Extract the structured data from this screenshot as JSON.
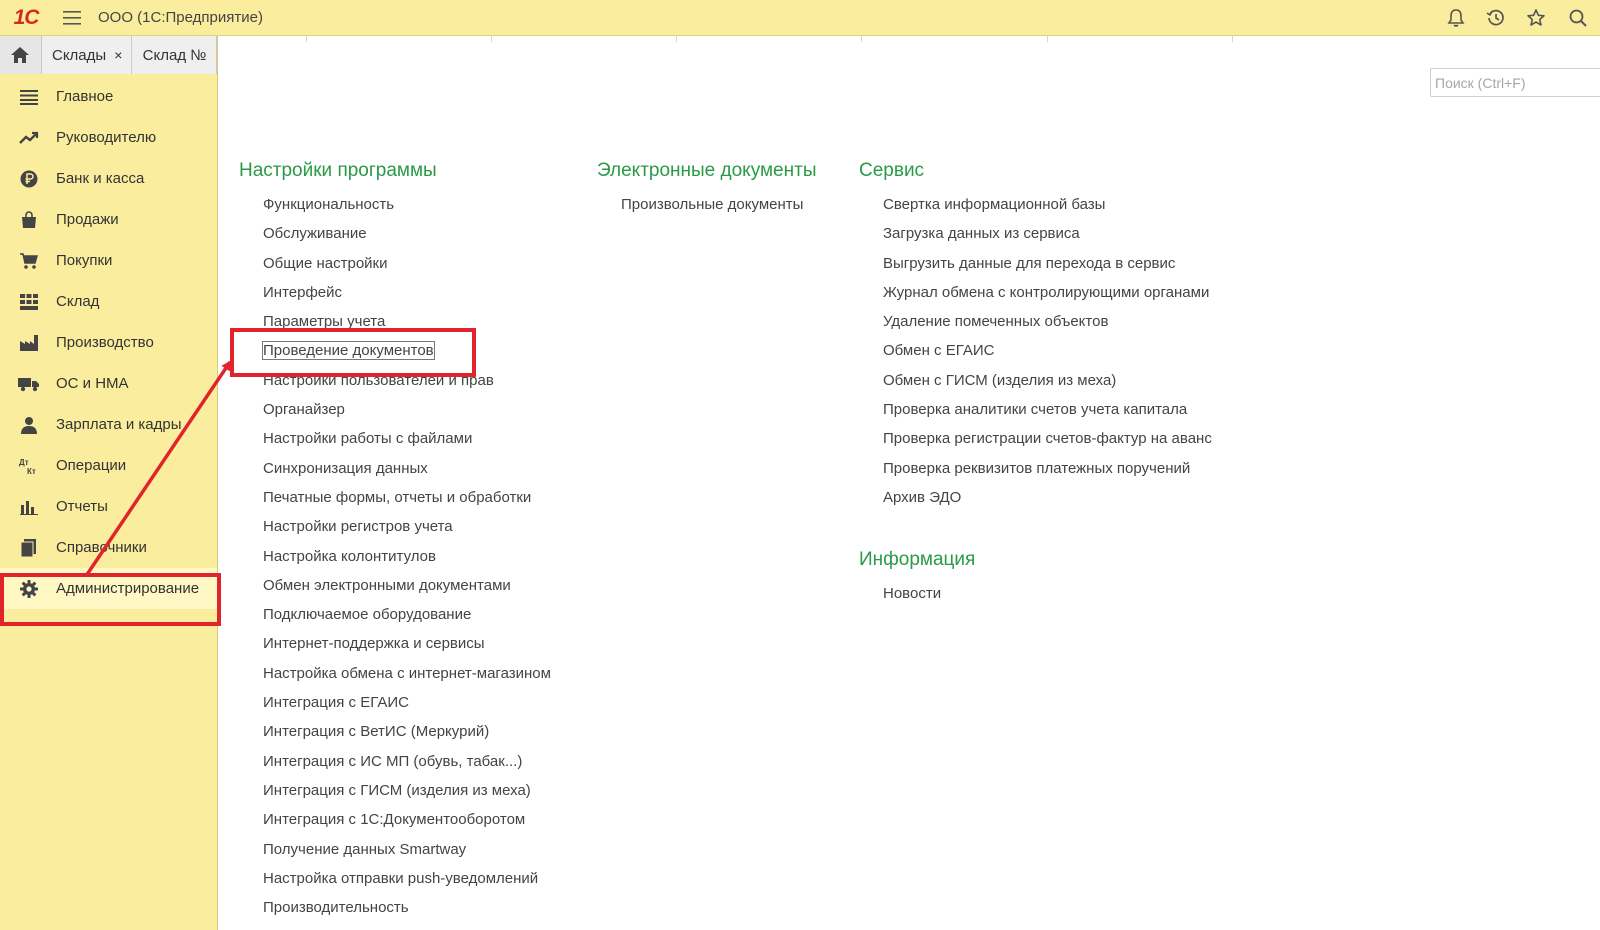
{
  "app": {
    "title": "ООО  (1С:Предприятие)",
    "logo_text": "1С"
  },
  "top_icons": [
    "bell-icon",
    "history-icon",
    "star-icon",
    "search-icon"
  ],
  "tabs": [
    {
      "label": "Склады",
      "close": "×"
    },
    {
      "label": "Склад №"
    }
  ],
  "nav": [
    {
      "label": "Главное",
      "icon": "menu-lines-icon"
    },
    {
      "label": "Руководителю",
      "icon": "trend-up-icon"
    },
    {
      "label": "Банк и касса",
      "icon": "ruble-coin-icon"
    },
    {
      "label": "Продажи",
      "icon": "shopping-bag-icon"
    },
    {
      "label": "Покупки",
      "icon": "cart-icon"
    },
    {
      "label": "Склад",
      "icon": "warehouse-grid-icon"
    },
    {
      "label": "Производство",
      "icon": "factory-icon"
    },
    {
      "label": "ОС и НМА",
      "icon": "truck-icon"
    },
    {
      "label": "Зарплата и кадры",
      "icon": "person-icon"
    },
    {
      "label": "Операции",
      "icon": "debit-credit-icon"
    },
    {
      "label": "Отчеты",
      "icon": "bar-chart-icon"
    },
    {
      "label": "Справочники",
      "icon": "books-icon"
    },
    {
      "label": "Администрирование",
      "icon": "gear-icon"
    }
  ],
  "active_nav": "Администрирование",
  "search": {
    "placeholder": "Поиск (Ctrl+F)"
  },
  "sections": {
    "program_settings": {
      "title": "Настройки программы",
      "items": [
        "Функциональность",
        "Обслуживание",
        "Общие настройки",
        "Интерфейс",
        "Параметры учета",
        "Проведение документов",
        "Настройки пользователей и прав",
        "Органайзер",
        "Настройки работы с файлами",
        "Синхронизация данных",
        "Печатные формы, отчеты и обработки",
        "Настройки регистров учета",
        "Настройка колонтитулов",
        "Обмен электронными документами",
        "Подключаемое оборудование",
        "Интернет-поддержка и сервисы",
        "Настройка обмена с интернет-магазином",
        "Интеграция с ЕГАИС",
        "Интеграция с ВетИС (Меркурий)",
        "Интеграция с ИС МП (обувь, табак...)",
        "Интеграция с ГИСМ (изделия из меха)",
        "Интеграция с 1С:Документооборотом",
        "Получение данных Smartway",
        "Настройка отправки push-уведомлений",
        "Производительность"
      ]
    },
    "edocs": {
      "title": "Электронные документы",
      "items": [
        "Произвольные документы"
      ]
    },
    "service": {
      "title": "Сервис",
      "items": [
        "Свертка информационной базы",
        "Загрузка данных из сервиса",
        "Выгрузить данные для перехода в сервис",
        "Журнал обмена с контролирующими органами",
        "Удаление помеченных объектов",
        "Обмен с ЕГАИС",
        "Обмен с ГИСМ (изделия из меха)",
        "Проверка аналитики счетов учета капитала",
        "Проверка регистрации счетов-фактур на аванс",
        "Проверка реквизитов платежных поручений",
        "Архив ЭДО"
      ]
    },
    "info": {
      "title": "Информация",
      "items": [
        "Новости"
      ]
    }
  },
  "highlighted_item": "Проведение документов",
  "colors": {
    "panel": "#fbed9e",
    "section_title": "#2b9a47",
    "annotation": "#e0242b"
  }
}
